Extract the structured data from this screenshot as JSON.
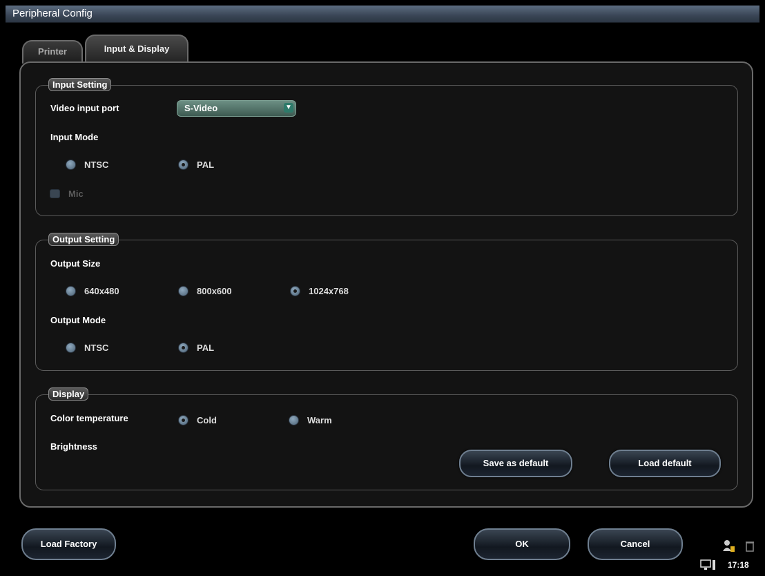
{
  "window": {
    "title": "Peripheral Config"
  },
  "tabs": [
    {
      "label": "Printer",
      "active": false
    },
    {
      "label": "Input & Display",
      "active": true
    }
  ],
  "input_setting": {
    "legend": "Input Setting",
    "video_input_port_label": "Video input port",
    "video_input_port_value": "S-Video",
    "input_mode_label": "Input Mode",
    "input_mode_options": [
      {
        "label": "NTSC",
        "selected": false
      },
      {
        "label": "PAL",
        "selected": true
      }
    ],
    "mic_label": "Mic",
    "mic_checked": false,
    "mic_enabled": false
  },
  "output_setting": {
    "legend": "Output Setting",
    "output_size_label": "Output Size",
    "output_size_options": [
      {
        "label": "640x480",
        "selected": false
      },
      {
        "label": "800x600",
        "selected": false
      },
      {
        "label": "1024x768",
        "selected": true
      }
    ],
    "output_mode_label": "Output Mode",
    "output_mode_options": [
      {
        "label": "NTSC",
        "selected": false
      },
      {
        "label": "PAL",
        "selected": true
      }
    ]
  },
  "display": {
    "legend": "Display",
    "color_temp_label": "Color temperature",
    "color_temp_options": [
      {
        "label": "Cold",
        "selected": true
      },
      {
        "label": "Warm",
        "selected": false
      }
    ],
    "brightness_label": "Brightness",
    "save_default_label": "Save as default",
    "load_default_label": "Load default"
  },
  "footer": {
    "load_factory_label": "Load Factory",
    "ok_label": "OK",
    "cancel_label": "Cancel"
  },
  "status_bar": {
    "time": "17:18",
    "icons": [
      "user-icon",
      "trash-icon",
      "monitor-icon"
    ]
  }
}
